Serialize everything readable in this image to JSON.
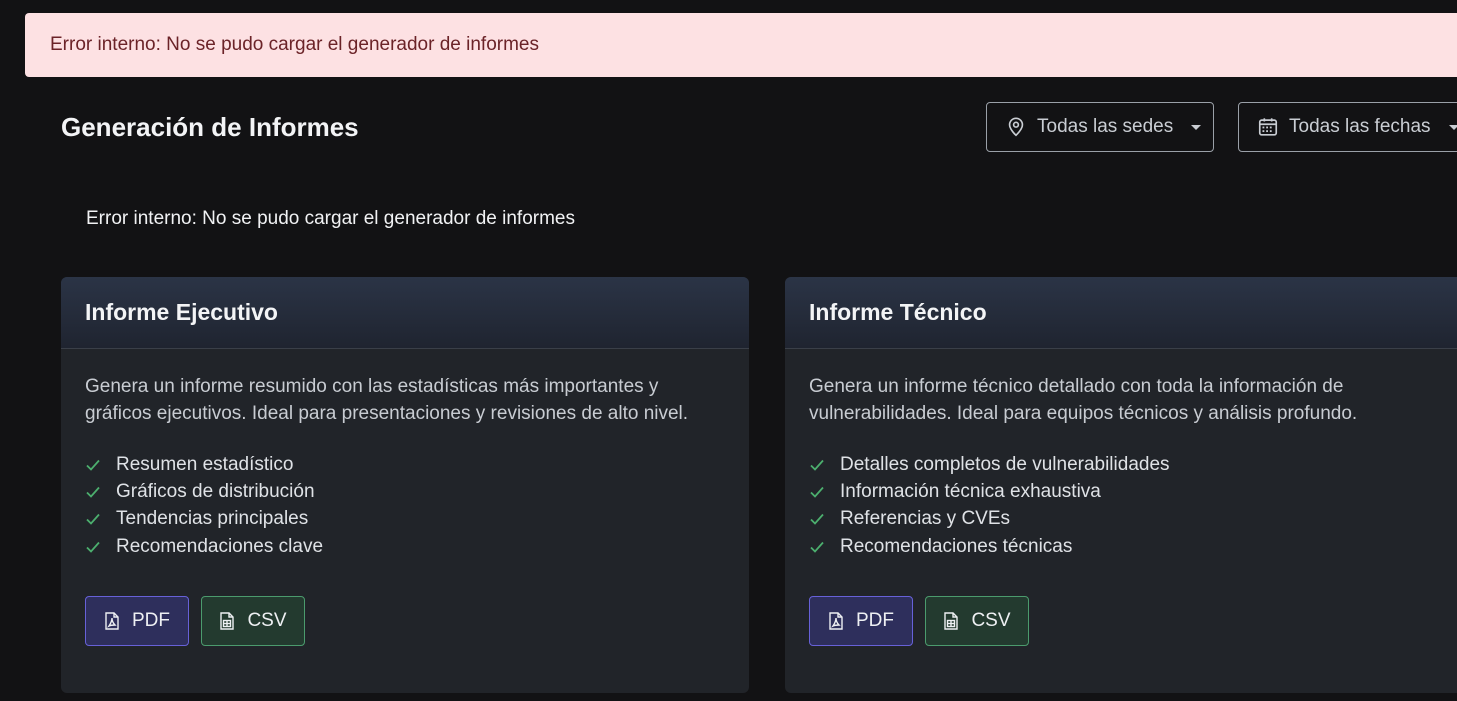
{
  "alert_top": {
    "message": "Error interno: No se pudo cargar el generador de informes"
  },
  "header": {
    "title": "Generación de Informes",
    "filters": {
      "sedes": {
        "icon": "map-pin-icon",
        "label": "Todas las sedes"
      },
      "fechas": {
        "icon": "calendar-icon",
        "label": "Todas las fechas"
      }
    }
  },
  "error_inline": {
    "message": "Error interno: No se pudo cargar el generador de informes"
  },
  "cards": [
    {
      "title": "Informe Ejecutivo",
      "description": "Genera un informe resumido con las estadísticas más importantes y gráficos ejecutivos. Ideal para presentaciones y revisiones de alto nivel.",
      "features": [
        "Resumen estadístico",
        "Gráficos de distribución",
        "Tendencias principales",
        "Recomendaciones clave"
      ],
      "buttons": {
        "pdf": "PDF",
        "csv": "CSV"
      }
    },
    {
      "title": "Informe Técnico",
      "description": "Genera un informe técnico detallado con toda la información de vulnerabilidades. Ideal para equipos técnicos y análisis profundo.",
      "features": [
        "Detalles completos de vulnerabilidades",
        "Información técnica exhaustiva",
        "Referencias y CVEs",
        "Recomendaciones técnicas"
      ],
      "buttons": {
        "pdf": "PDF",
        "csv": "CSV"
      }
    }
  ],
  "colors": {
    "background": "#121214",
    "alert_bg": "#fde1e3",
    "card_bg": "#212429",
    "check": "#4caf6e",
    "pdf_border": "#6761d8",
    "csv_border": "#4b9b6d"
  }
}
